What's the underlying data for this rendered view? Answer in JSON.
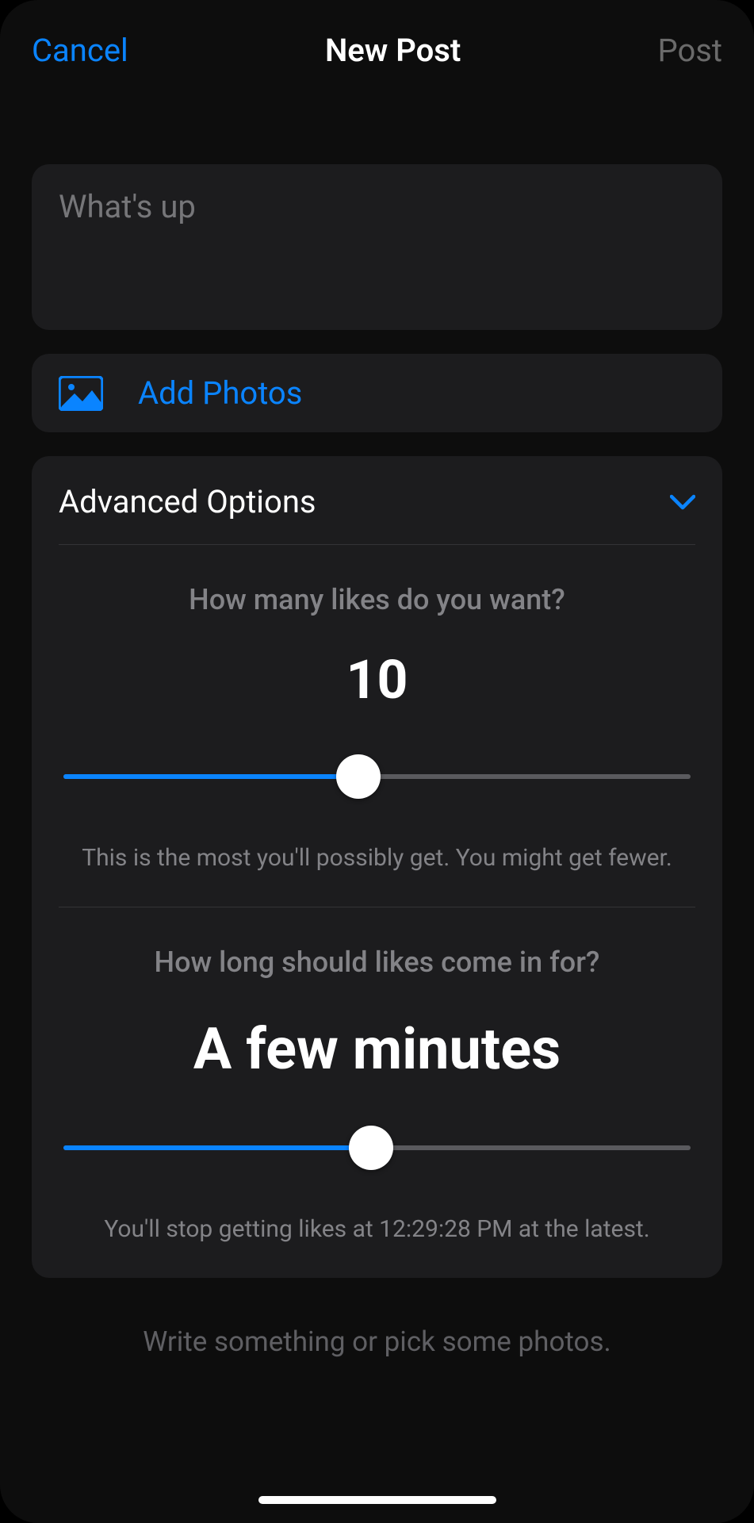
{
  "nav": {
    "cancel": "Cancel",
    "title": "New Post",
    "post": "Post"
  },
  "composer": {
    "placeholder": "What's up"
  },
  "add_photos": {
    "label": "Add Photos"
  },
  "advanced": {
    "title": "Advanced Options",
    "likes": {
      "question": "How many likes do you want?",
      "value": "10",
      "slider_percent": 47,
      "hint": "This is the most you'll possibly get. You might get fewer."
    },
    "duration": {
      "question": "How long should likes come in for?",
      "value": "A few minutes",
      "slider_percent": 49,
      "hint": "You'll stop getting likes at 12:29:28 PM at the latest."
    }
  },
  "footer_hint": "Write something or pick some photos."
}
